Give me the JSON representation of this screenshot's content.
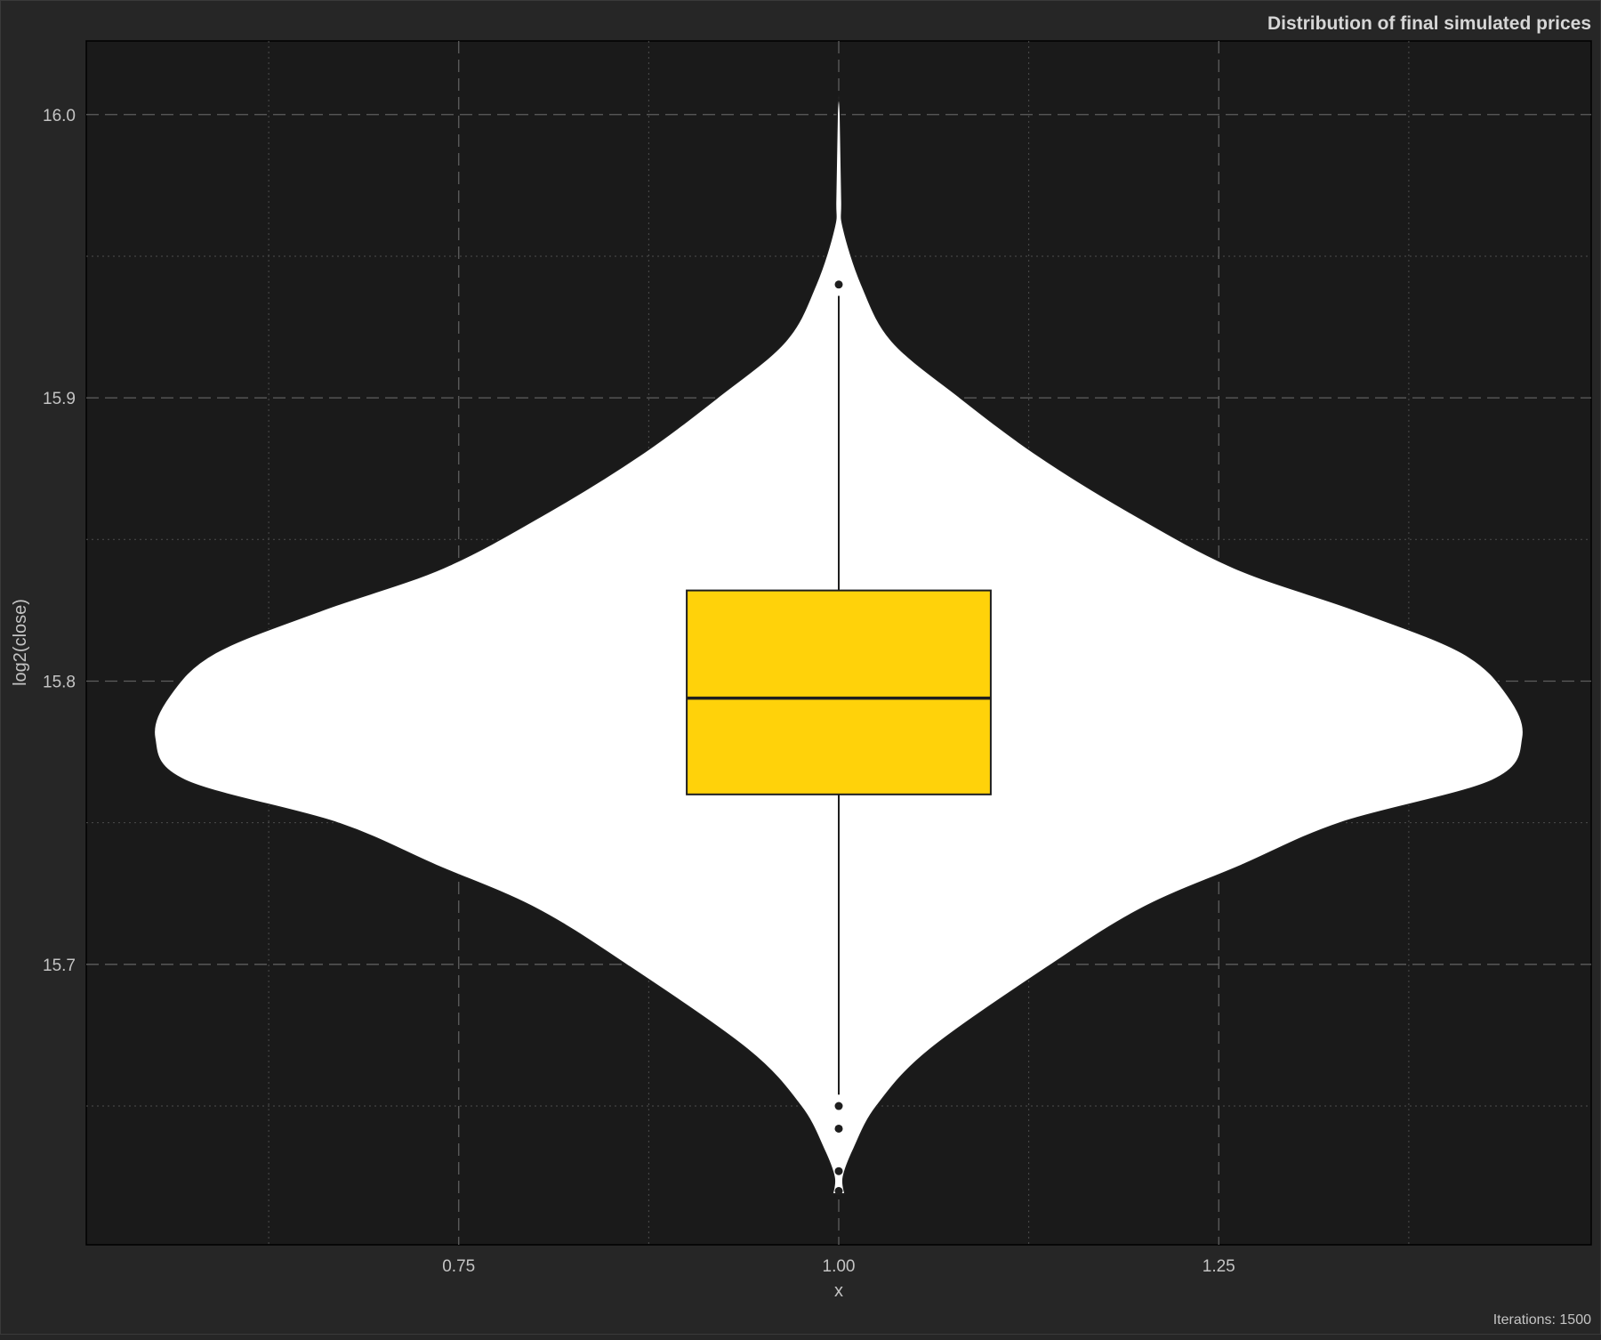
{
  "chart_data": {
    "type": "violin",
    "title": "Distribution of final simulated prices",
    "caption": "Iterations: 1500",
    "xlabel": "x",
    "ylabel": "log2(close)",
    "x_category": 1.0,
    "xlim": [
      0.505,
      1.495
    ],
    "ylim": [
      15.601,
      16.026
    ],
    "x_ticks": [
      0.75,
      1.0,
      1.25
    ],
    "x_tick_labels": [
      "0.75",
      "1.00",
      "1.25"
    ],
    "y_ticks": [
      15.7,
      15.8,
      15.9,
      16.0
    ],
    "y_tick_labels": [
      "15.7",
      "15.8",
      "15.9",
      "16.0"
    ],
    "grid": true,
    "legend": "none",
    "violin": {
      "fill": "#ffffff",
      "y_min": 15.619,
      "y_max": 16.006,
      "profile": [
        {
          "y": 15.619,
          "half_width": 0.004
        },
        {
          "y": 15.625,
          "half_width": 0.003
        },
        {
          "y": 15.635,
          "half_width": 0.01
        },
        {
          "y": 15.65,
          "half_width": 0.025
        },
        {
          "y": 15.67,
          "half_width": 0.06
        },
        {
          "y": 15.7,
          "half_width": 0.14
        },
        {
          "y": 15.72,
          "half_width": 0.2
        },
        {
          "y": 15.735,
          "half_width": 0.265
        },
        {
          "y": 15.75,
          "half_width": 0.33
        },
        {
          "y": 15.765,
          "half_width": 0.43
        },
        {
          "y": 15.78,
          "half_width": 0.45
        },
        {
          "y": 15.795,
          "half_width": 0.44
        },
        {
          "y": 15.81,
          "half_width": 0.41
        },
        {
          "y": 15.825,
          "half_width": 0.34
        },
        {
          "y": 15.84,
          "half_width": 0.26
        },
        {
          "y": 15.86,
          "half_width": 0.19
        },
        {
          "y": 15.88,
          "half_width": 0.13
        },
        {
          "y": 15.9,
          "half_width": 0.08
        },
        {
          "y": 15.92,
          "half_width": 0.035
        },
        {
          "y": 15.94,
          "half_width": 0.015
        },
        {
          "y": 15.96,
          "half_width": 0.003
        },
        {
          "y": 15.97,
          "half_width": 0.002
        },
        {
          "y": 16.0,
          "half_width": 0.001
        },
        {
          "y": 16.006,
          "half_width": 0.0
        }
      ]
    },
    "boxplot": {
      "fill": "#ffd20a",
      "width": 0.2,
      "q1": 15.76,
      "median": 15.794,
      "q3": 15.832,
      "whisker_low": 15.654,
      "whisker_high": 15.936,
      "outliers": [
        15.65,
        15.642,
        15.627,
        15.94,
        15.62
      ]
    }
  }
}
